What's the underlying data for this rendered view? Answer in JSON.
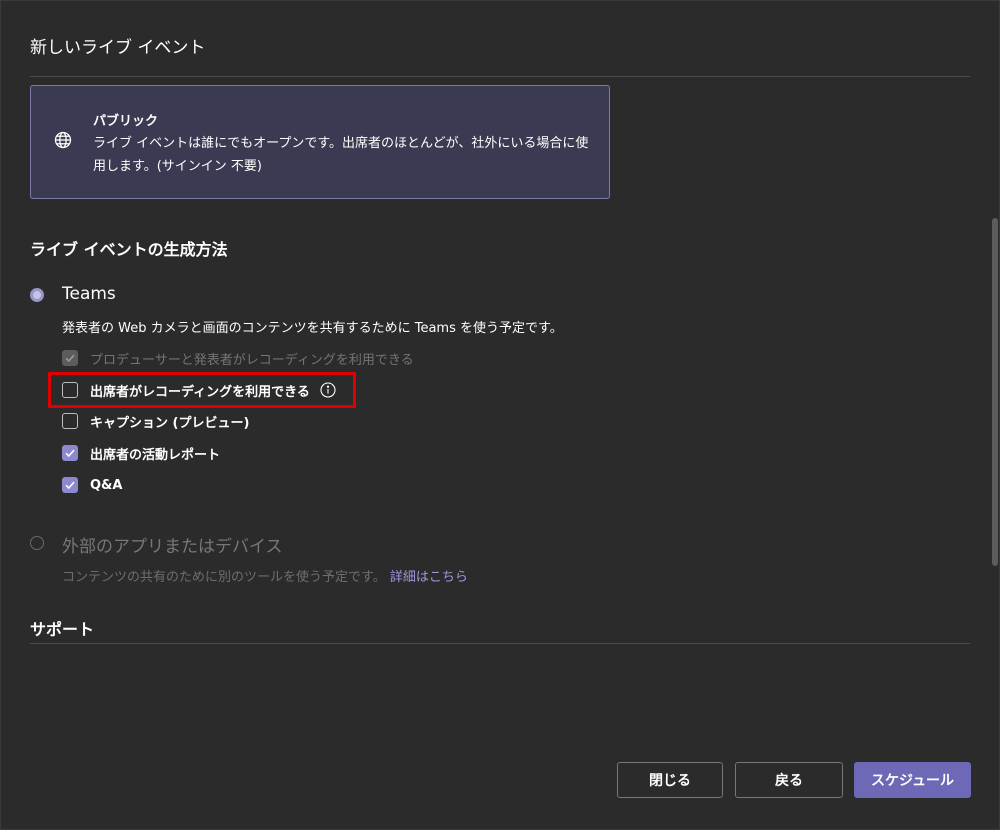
{
  "dialog": {
    "title": "新しいライブ イベント"
  },
  "visibility_card": {
    "icon": "globe-icon",
    "title": "パブリック",
    "description": "ライブ イベントは誰にでもオープンです。出席者のほとんどが、社外にいる場合に使用します。(サインイン 不要)"
  },
  "production": {
    "heading": "ライブ イベントの生成方法",
    "teams_option": {
      "label": "Teams",
      "selected": true,
      "description": "発表者の Web カメラと画面のコンテンツを共有するために Teams を使う予定です。"
    },
    "options": [
      {
        "label": "プロデューサーと発表者がレコーディングを利用できる",
        "checked": true,
        "disabled": true
      },
      {
        "label": "出席者がレコーディングを利用できる",
        "checked": false,
        "disabled": false,
        "has_info_icon": true
      },
      {
        "label": "キャプション (プレビュー)",
        "checked": false,
        "disabled": false
      },
      {
        "label": "出席者の活動レポート",
        "checked": true,
        "disabled": false
      },
      {
        "label": "Q&A",
        "checked": true,
        "disabled": false
      }
    ],
    "external_option": {
      "label": "外部のアプリまたはデバイス",
      "selected": false,
      "description": "コンテンツの共有のために別のツールを使う予定です。",
      "link_text": "詳細はこちら"
    }
  },
  "support": {
    "heading": "サポート"
  },
  "footer": {
    "close_label": "閉じる",
    "back_label": "戻る",
    "schedule_label": "スケジュール"
  },
  "colors": {
    "background": "#2b2b2b",
    "accent": "#6d69b6",
    "card_background": "#3b3a53",
    "highlight": "#e00000"
  }
}
